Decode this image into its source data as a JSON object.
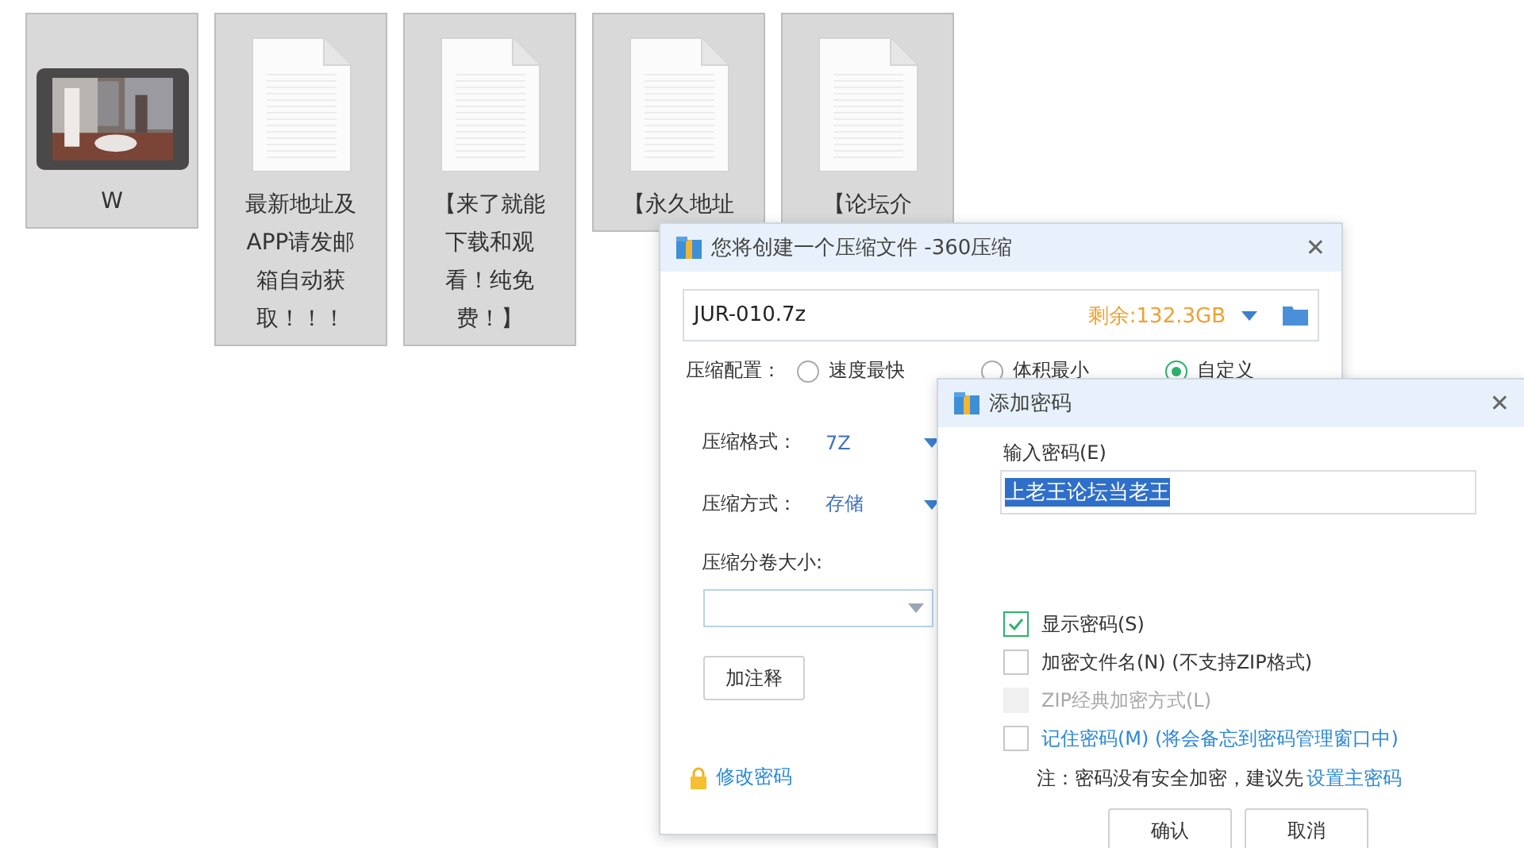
{
  "desktop_icons": [
    {
      "kind": "video",
      "label": "W",
      "selected": true
    },
    {
      "kind": "document",
      "label": "最新地址及APP请发邮箱自动获取！！！",
      "selected": true
    },
    {
      "kind": "document",
      "label": "【来了就能下载和观看！纯免费！】",
      "selected": true
    },
    {
      "kind": "document",
      "label": "【永久地址",
      "selected": true
    },
    {
      "kind": "document",
      "label": "【论坛介",
      "selected": true
    }
  ],
  "compress_dialog": {
    "title": "您将创建一个压缩文件 -360压缩",
    "filename": "JUR-010.7z",
    "free_space": "剩余:132.3GB",
    "config_label": "压缩配置：",
    "config_options": [
      {
        "label": "速度最快",
        "selected": false
      },
      {
        "label": "体积最小",
        "selected": false
      },
      {
        "label": "自定义",
        "selected": true
      }
    ],
    "format": {
      "label": "压缩格式：",
      "value": "7Z"
    },
    "method": {
      "label": "压缩方式：",
      "value": "存储"
    },
    "split_label": "压缩分卷大小:",
    "comment_button": "加注释",
    "change_password_link": "修改密码",
    "close_button": "✕"
  },
  "password_dialog": {
    "title": "添加密码",
    "field_label": "输入密码(E)",
    "password": {
      "value": "上老王论坛当老王",
      "selected": true
    },
    "options": [
      {
        "kind": "plain",
        "label": "显示密码(S)",
        "checked": true,
        "disabled": false
      },
      {
        "kind": "plain",
        "label": "加密文件名(N) (不支持ZIP格式)",
        "checked": false,
        "disabled": false
      },
      {
        "kind": "plain",
        "label": "ZIP经典加密方式(L)",
        "checked": false,
        "disabled": true
      },
      {
        "kind": "link",
        "label": "记住密码(M) (将会备忘到密码管理窗口中)",
        "checked": false,
        "disabled": false
      }
    ],
    "note": "注：密码没有安全加密，建议先",
    "note_link": "设置主密码",
    "buttons": [
      "确认",
      "取消"
    ],
    "close_button": "✕"
  }
}
